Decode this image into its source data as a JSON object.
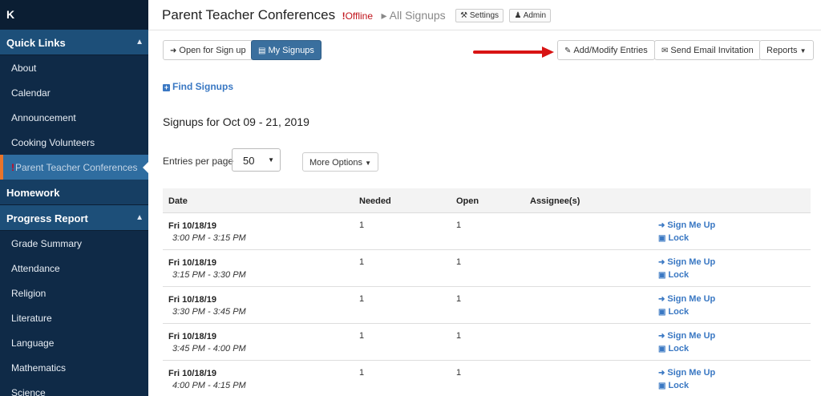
{
  "sidebar": {
    "logo": "K",
    "quick_links": {
      "label": "Quick Links",
      "items": [
        {
          "label": "About"
        },
        {
          "label": "Calendar"
        },
        {
          "label": "Announcement"
        },
        {
          "label": "Cooking Volunteers"
        },
        {
          "label": "Parent Teacher Conferences",
          "marker": "!"
        }
      ]
    },
    "homework": {
      "label": "Homework"
    },
    "progress_report": {
      "label": "Progress Report",
      "items": [
        {
          "label": "Grade Summary"
        },
        {
          "label": "Attendance"
        },
        {
          "label": "Religion"
        },
        {
          "label": "Literature"
        },
        {
          "label": "Language"
        },
        {
          "label": "Mathematics"
        },
        {
          "label": "Science"
        }
      ]
    }
  },
  "header": {
    "title": "Parent Teacher Conferences",
    "offline_marker": "!",
    "offline_label": "Offline",
    "breadcrumb_sep": "▸",
    "breadcrumb": "All Signups",
    "settings_label": "Settings",
    "admin_label": "Admin"
  },
  "toolbar": {
    "open_for_signup": "Open for Sign up",
    "my_signups": "My Signups",
    "add_modify": "Add/Modify Entries",
    "send_email": "Send Email Invitation",
    "reports": "Reports"
  },
  "find_signups": "Find Signups",
  "signups_title": "Signups for Oct 09 - 21, 2019",
  "entries_per_page": {
    "label": "Entries per page",
    "value": "50"
  },
  "more_options": "More Options",
  "table": {
    "headers": {
      "date": "Date",
      "needed": "Needed",
      "open": "Open",
      "assignees": "Assignee(s)"
    },
    "sign_label": "Sign Me Up",
    "lock_label": "Lock",
    "rows": [
      {
        "date": "Fri 10/18/19",
        "time": "3:00 PM - 3:15 PM",
        "needed": "1",
        "open": "1"
      },
      {
        "date": "Fri 10/18/19",
        "time": "3:15 PM - 3:30 PM",
        "needed": "1",
        "open": "1"
      },
      {
        "date": "Fri 10/18/19",
        "time": "3:30 PM - 3:45 PM",
        "needed": "1",
        "open": "1"
      },
      {
        "date": "Fri 10/18/19",
        "time": "3:45 PM - 4:00 PM",
        "needed": "1",
        "open": "1"
      },
      {
        "date": "Fri 10/18/19",
        "time": "4:00 PM - 4:15 PM",
        "needed": "1",
        "open": "1"
      }
    ]
  },
  "colors": {
    "sidebar_bg": "#0f2a47",
    "sidebar_section": "#1d4f79",
    "active_item": "#2f6da0",
    "accent_orange": "#e8742a",
    "link_blue": "#3a78c3",
    "primary_button": "#3a6f9e",
    "offline_red": "#c0141c",
    "annotation_arrow": "#d81414"
  }
}
